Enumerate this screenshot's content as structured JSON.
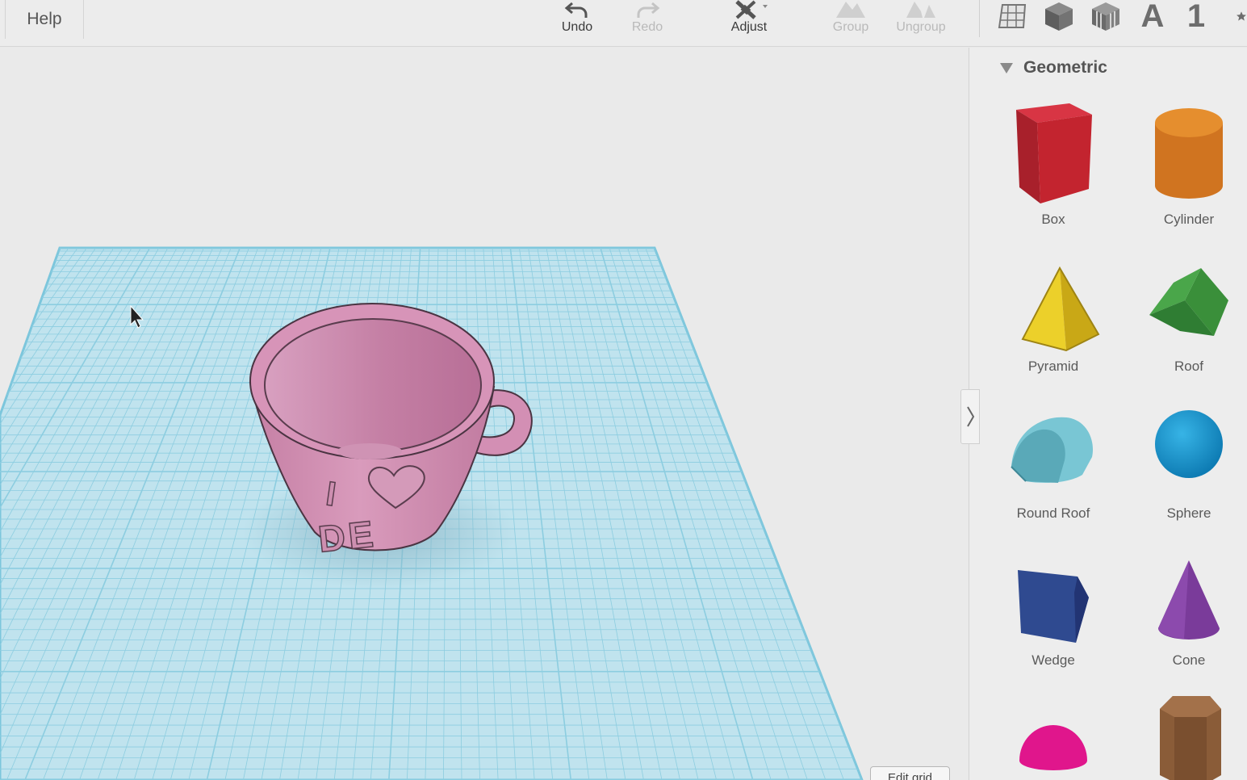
{
  "menu": {
    "help_label": "Help"
  },
  "toolbar": {
    "undo_label": "Undo",
    "redo_label": "Redo",
    "adjust_label": "Adjust",
    "group_label": "Group",
    "ungroup_label": "Ungroup"
  },
  "view_icons": {
    "text_glyph": "A",
    "number_glyph": "1"
  },
  "workplane": {
    "cup_text_line1": "I",
    "cup_text_line2": "DE",
    "edit_grid_label": "Edit grid"
  },
  "sidebar": {
    "section_title": "Geometric",
    "shapes": [
      {
        "name": "Box",
        "color": "#c0222e"
      },
      {
        "name": "Cylinder",
        "color": "#d8781e"
      },
      {
        "name": "Pyramid",
        "color": "#e8c81c"
      },
      {
        "name": "Roof",
        "color": "#3e9a3e"
      },
      {
        "name": "Round Roof",
        "color": "#6dc0cf"
      },
      {
        "name": "Sphere",
        "color": "#1898d0"
      },
      {
        "name": "Wedge",
        "color": "#2e4186"
      },
      {
        "name": "Cone",
        "color": "#7a3a9a"
      },
      {
        "name": "",
        "color": "#e0168c"
      },
      {
        "name": "",
        "color": "#8e603c"
      }
    ]
  },
  "colors": {
    "grid_fill": "#bfe3ee",
    "grid_line": "#8ccde0",
    "cup": "#d896b8"
  }
}
